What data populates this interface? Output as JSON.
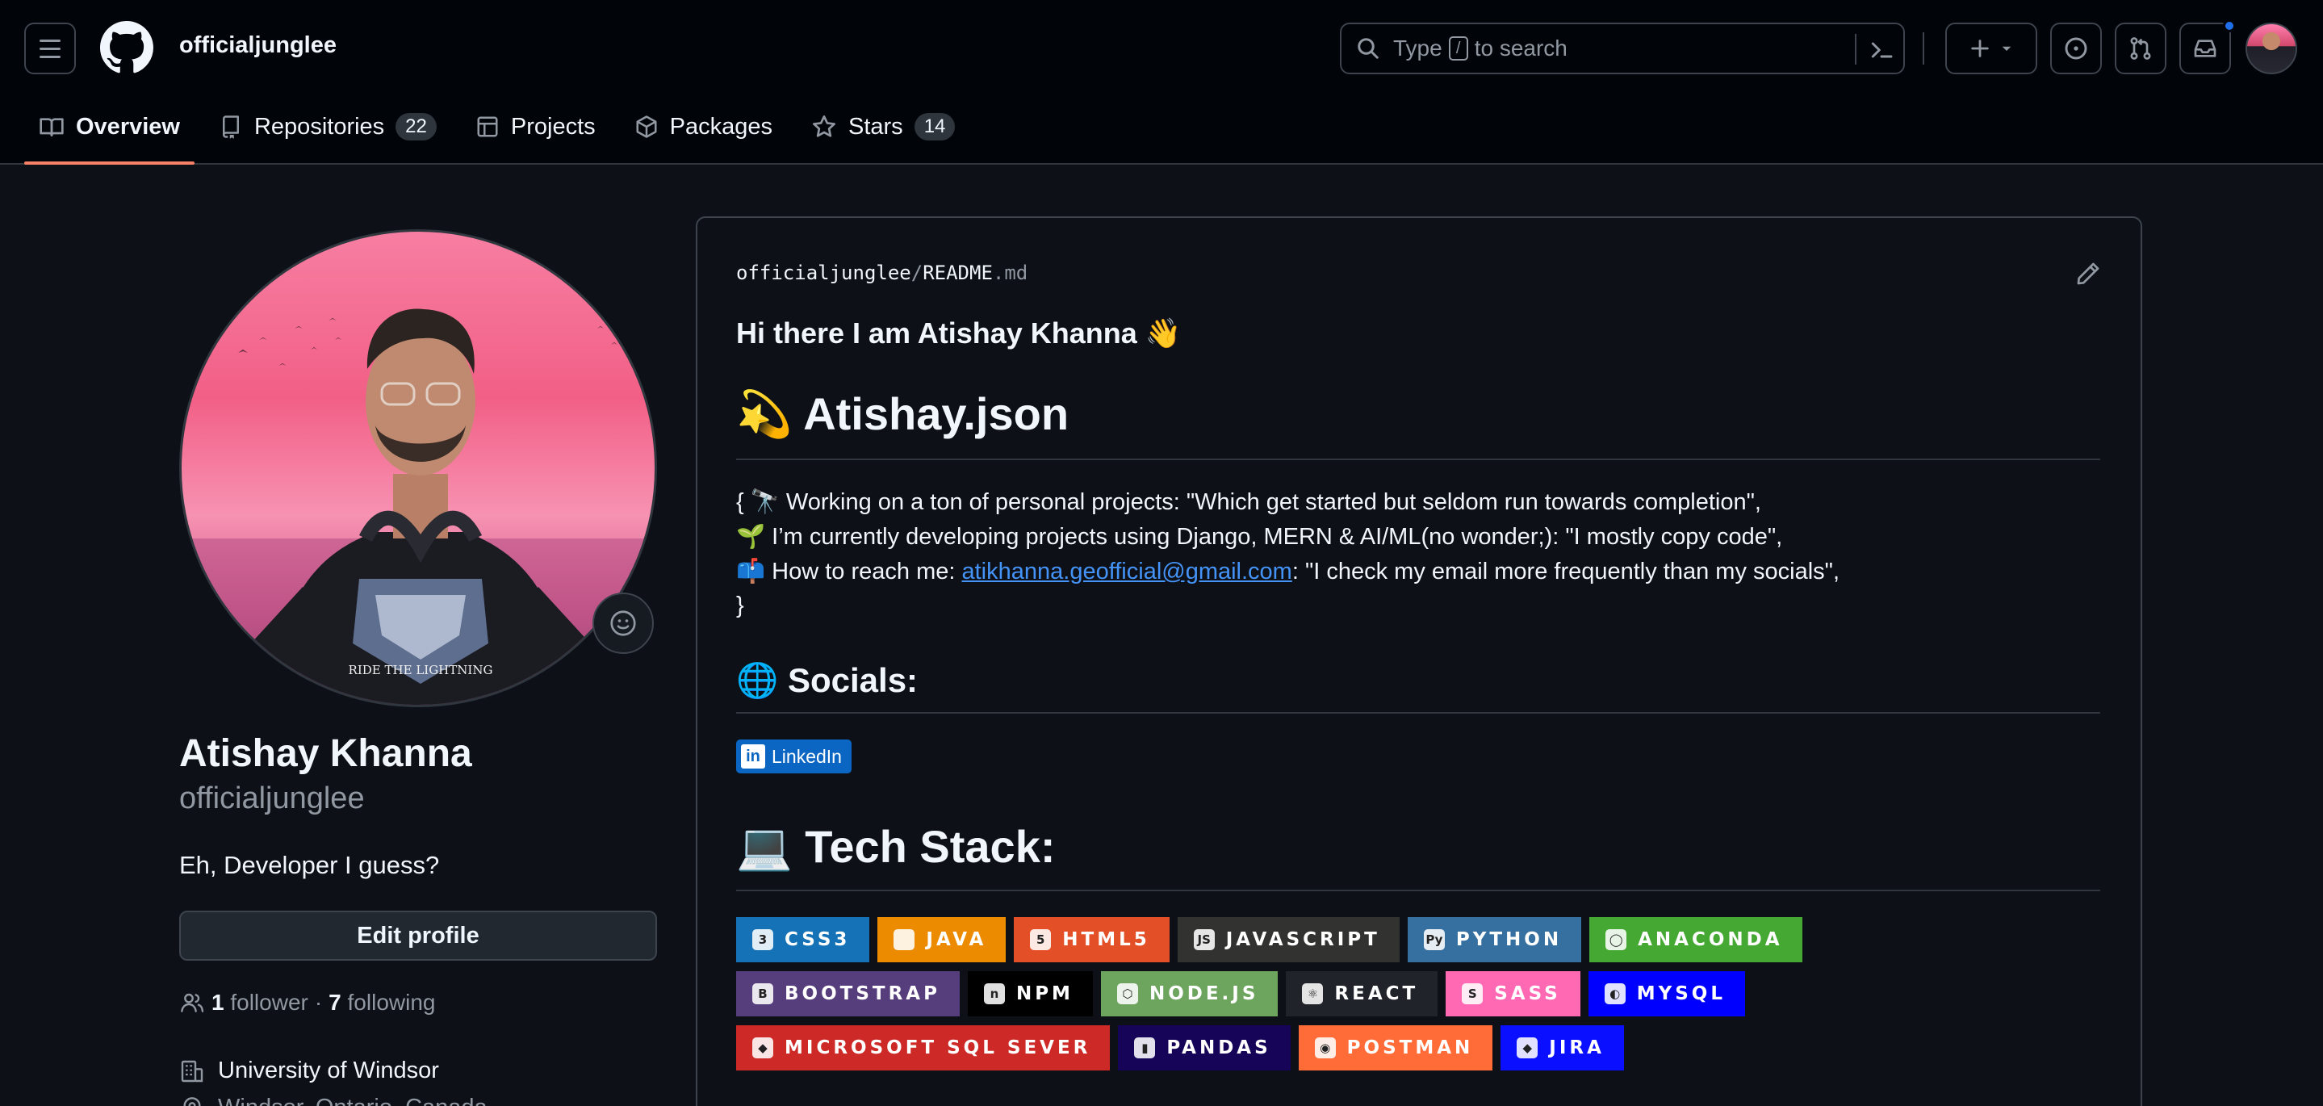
{
  "header": {
    "username": "officialjunglee",
    "search": {
      "prefix": "Type",
      "key": "/",
      "suffix": "to search"
    }
  },
  "tabs": [
    {
      "label": "Overview",
      "icon": "book-icon",
      "active": true
    },
    {
      "label": "Repositories",
      "icon": "repo-icon",
      "count": "22"
    },
    {
      "label": "Projects",
      "icon": "table-icon"
    },
    {
      "label": "Packages",
      "icon": "package-icon"
    },
    {
      "label": "Stars",
      "icon": "star-icon",
      "count": "14"
    }
  ],
  "profile": {
    "full_name": "Atishay Khanna",
    "login": "officialjunglee",
    "bio": "Eh, Developer I guess?",
    "edit_label": "Edit profile",
    "followers_count": "1",
    "followers_label": "follower",
    "dot": "·",
    "following_count": "7",
    "following_label": "following",
    "organization": "University of Windsor",
    "location": "Windsor, Ontario, Canada",
    "avatar_caption": "RIDE THE LIGHTNING"
  },
  "readme": {
    "path_user": "officialjunglee",
    "path_sep": "/",
    "path_file": "README",
    "path_ext": ".md",
    "greeting": "Hi there I am Atishay Khanna 👋",
    "title_emoji": "💫",
    "title": "Atishay.json",
    "lines": {
      "line1_emoji": "🔭",
      "line1": "Working on a ton of personal projects: \"Which get started but seldom run towards completion\",",
      "line2_emoji": "🌱",
      "line2": "I’m currently developing projects using Django, MERN & AI/ML(no wonder;): \"I mostly copy code\",",
      "line3_emoji": "📫",
      "line3_prefix": "How to reach me: ",
      "email": "atikhanna.geofficial@gmail.com",
      "line3_suffix": ": \"I check my email more frequently than my socials\",",
      "open_brace": "{",
      "close_brace": "}"
    },
    "socials_emoji": "🌐",
    "socials_heading": "Socials:",
    "linkedin_label": "LinkedIn",
    "tech_emoji": "💻",
    "tech_heading": "Tech Stack:",
    "badges": [
      {
        "label": "CSS3",
        "color": "#1572B6",
        "icon": "3"
      },
      {
        "label": "JAVA",
        "color": "#ED8B00",
        "icon": ""
      },
      {
        "label": "HTML5",
        "color": "#E34F26",
        "icon": "5"
      },
      {
        "label": "JAVASCRIPT",
        "color": "#323330",
        "icon": "JS"
      },
      {
        "label": "PYTHON",
        "color": "#3670A0",
        "icon": "Py"
      },
      {
        "label": "ANACONDA",
        "color": "#44A833",
        "icon": "◯"
      },
      {
        "label": "BOOTSTRAP",
        "color": "#563D7C",
        "icon": "B"
      },
      {
        "label": "NPM",
        "color": "#000000",
        "icon": "n"
      },
      {
        "label": "NODE.JS",
        "color": "#6DA55F",
        "icon": "⬡"
      },
      {
        "label": "REACT",
        "color": "#20232A",
        "icon": "⚛"
      },
      {
        "label": "SASS",
        "color": "#FF69B4",
        "icon": "S"
      },
      {
        "label": "MYSQL",
        "color": "#0000FF",
        "icon": "◐"
      },
      {
        "label": "MICROSOFT SQL SEVER",
        "color": "#CC2927",
        "icon": "◆"
      },
      {
        "label": "PANDAS",
        "color": "#150458",
        "icon": "▮"
      },
      {
        "label": "POSTMAN",
        "color": "#FF6C37",
        "icon": "◉"
      },
      {
        "label": "JIRA",
        "color": "#0A0FFF",
        "icon": "◆"
      }
    ]
  }
}
